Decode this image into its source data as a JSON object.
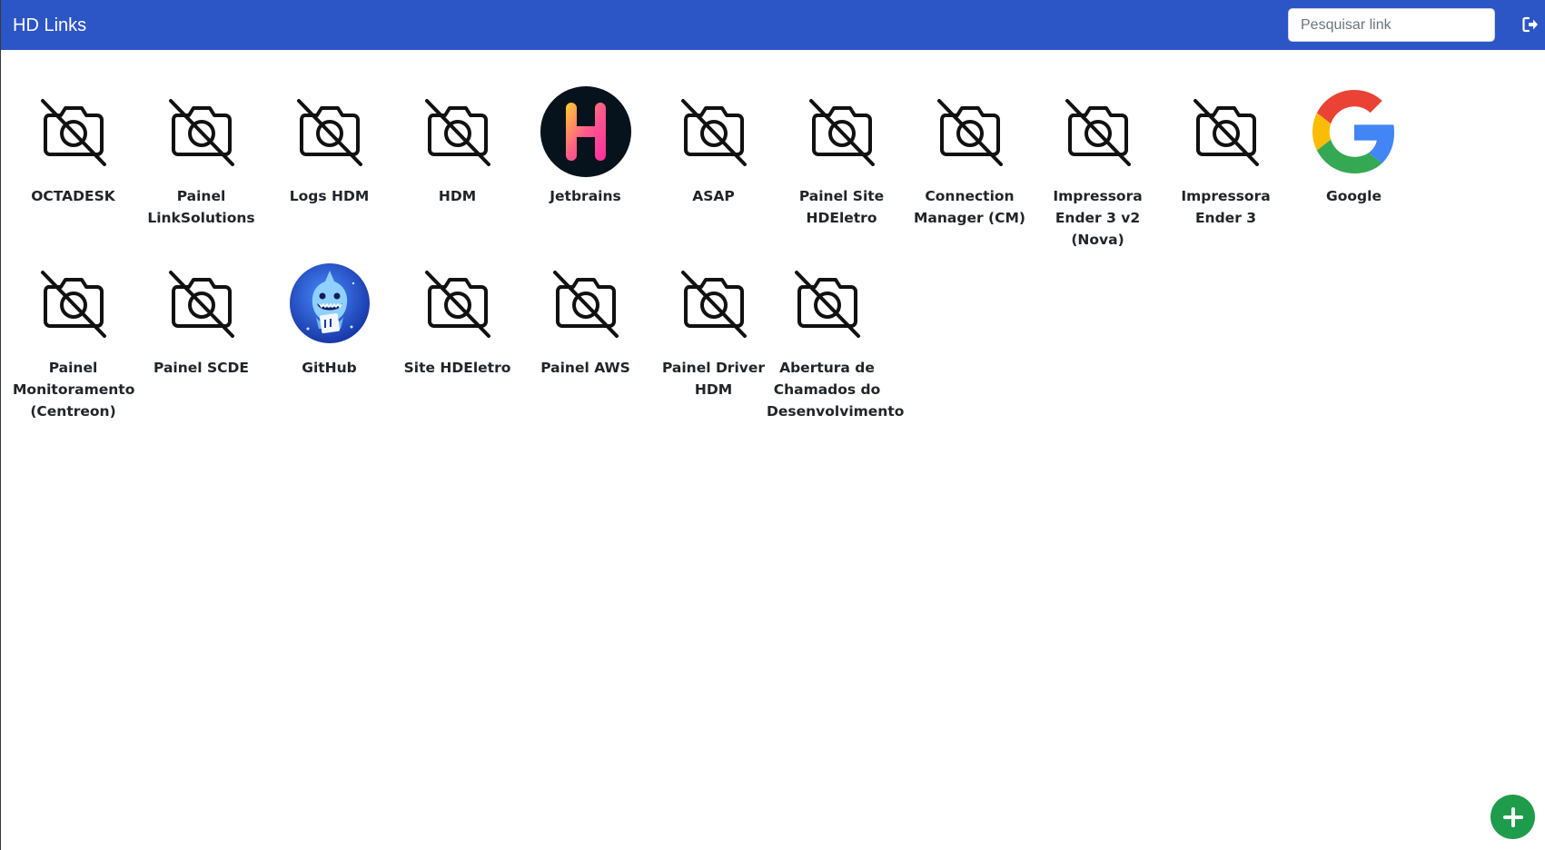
{
  "header": {
    "title": "HD Links",
    "search_placeholder": "Pesquisar link",
    "logout_icon": "sign-out-icon"
  },
  "colors": {
    "navbar": "#2c55c6",
    "fab": "#1e9c4b"
  },
  "links": [
    {
      "label": "OCTADESK",
      "icon": "camera-off-icon"
    },
    {
      "label": "Painel LinkSolutions",
      "icon": "camera-off-icon"
    },
    {
      "label": "Logs HDM",
      "icon": "camera-off-icon"
    },
    {
      "label": "HDM",
      "icon": "camera-off-icon"
    },
    {
      "label": "Jetbrains",
      "icon": "jetbrains-logo-icon"
    },
    {
      "label": "ASAP",
      "icon": "camera-off-icon"
    },
    {
      "label": "Painel Site HDEletro",
      "icon": "camera-off-icon"
    },
    {
      "label": "Connection Manager (CM)",
      "icon": "camera-off-icon"
    },
    {
      "label": "Impressora Ender 3 v2 (Nova)",
      "icon": "camera-off-icon"
    },
    {
      "label": "Impressora Ender 3",
      "icon": "camera-off-icon"
    },
    {
      "label": "Google",
      "icon": "google-logo-icon"
    },
    {
      "label": "Painel Monitoramento (Centreon)",
      "icon": "camera-off-icon"
    },
    {
      "label": "Painel SCDE",
      "icon": "camera-off-icon"
    },
    {
      "label": "GitHub",
      "icon": "github-shark-logo-icon"
    },
    {
      "label": "Site HDEletro",
      "icon": "camera-off-icon"
    },
    {
      "label": "Painel AWS",
      "icon": "camera-off-icon"
    },
    {
      "label": "Painel Driver HDM",
      "icon": "camera-off-icon"
    },
    {
      "label": "Abertura de Chamados do Desenvolvimento",
      "icon": "camera-off-icon"
    }
  ],
  "fab": {
    "icon": "plus-icon"
  }
}
